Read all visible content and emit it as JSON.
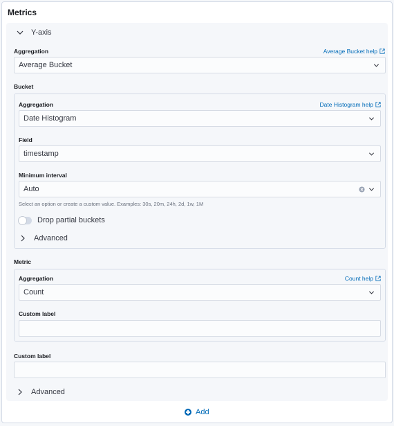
{
  "panel": {
    "title": "Metrics"
  },
  "y_axis": {
    "toggle_label": "Y-axis",
    "aggregation_label": "Aggregation",
    "aggregation_help": "Average Bucket help",
    "aggregation_value": "Average Bucket",
    "bucket_label": "Bucket",
    "bucket": {
      "aggregation_label": "Aggregation",
      "aggregation_help": "Date Histogram help",
      "aggregation_value": "Date Histogram",
      "field_label": "Field",
      "field_value": "timestamp",
      "interval_label": "Minimum interval",
      "interval_value": "Auto",
      "interval_hint": "Select an option or create a custom value. Examples: 30s, 20m, 24h, 2d, 1w, 1M",
      "drop_partial_label": "Drop partial buckets",
      "drop_partial_enabled": false,
      "advanced_label": "Advanced"
    },
    "metric_label": "Metric",
    "metric": {
      "aggregation_label": "Aggregation",
      "aggregation_help": "Count help",
      "aggregation_value": "Count",
      "custom_label_label": "Custom label",
      "custom_label_value": ""
    },
    "custom_label_label": "Custom label",
    "custom_label_value": "",
    "advanced_label": "Advanced"
  },
  "add_button": {
    "label": "Add"
  },
  "colors": {
    "accent": "#006bb8",
    "text": "#343741",
    "border": "#d3dae6"
  }
}
